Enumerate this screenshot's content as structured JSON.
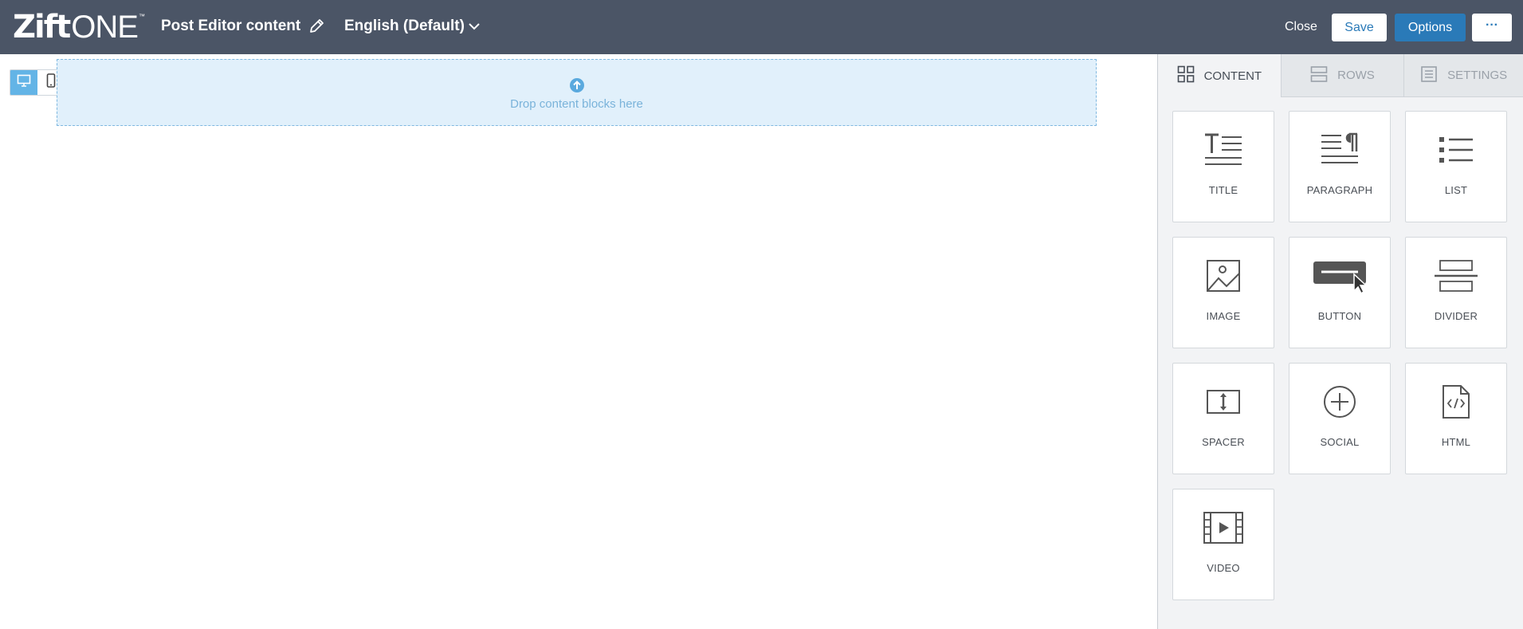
{
  "header": {
    "logo_bold": "Zift",
    "logo_light": "ONE",
    "logo_tm": "™",
    "title": "Post Editor content",
    "language": "English (Default)",
    "close_label": "Close",
    "save_label": "Save",
    "options_label": "Options",
    "more_label": "···"
  },
  "canvas": {
    "drop_text": "Drop content blocks here"
  },
  "panel": {
    "tabs": [
      {
        "label": "CONTENT",
        "icon": "grid-icon",
        "active": true
      },
      {
        "label": "ROWS",
        "icon": "rows-icon",
        "active": false
      },
      {
        "label": "SETTINGS",
        "icon": "settings-icon",
        "active": false
      }
    ],
    "blocks": [
      {
        "label": "TITLE",
        "icon": "title-icon"
      },
      {
        "label": "PARAGRAPH",
        "icon": "paragraph-icon"
      },
      {
        "label": "LIST",
        "icon": "list-icon"
      },
      {
        "label": "IMAGE",
        "icon": "image-icon"
      },
      {
        "label": "BUTTON",
        "icon": "button-icon"
      },
      {
        "label": "DIVIDER",
        "icon": "divider-icon"
      },
      {
        "label": "SPACER",
        "icon": "spacer-icon"
      },
      {
        "label": "SOCIAL",
        "icon": "social-icon"
      },
      {
        "label": "HTML",
        "icon": "html-icon"
      },
      {
        "label": "VIDEO",
        "icon": "video-icon"
      }
    ]
  },
  "colors": {
    "topbar": "#4b5566",
    "accent": "#2a7ab8",
    "dropzone": "#e1f0fb",
    "device_active": "#63b4e6"
  }
}
